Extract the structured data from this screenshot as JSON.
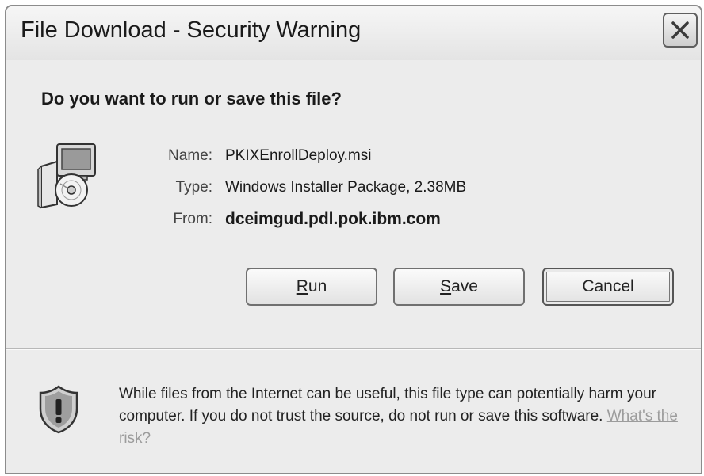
{
  "window": {
    "title": "File Download - Security Warning"
  },
  "question": "Do you want to run or save this file?",
  "file": {
    "name_label": "Name:",
    "name_value": "PKIXEnrollDeploy.msi",
    "type_label": "Type:",
    "type_value": "Windows Installer Package, 2.38MB",
    "from_label": "From:",
    "from_value": "dceimgud.pdl.pok.ibm.com"
  },
  "buttons": {
    "run_rest": "un",
    "run_mnemonic": "R",
    "save_rest": "ave",
    "save_mnemonic": "S",
    "cancel": "Cancel"
  },
  "warning": {
    "text": "While files from the Internet can be useful, this file type can potentially harm your computer. If you do not trust the source, do not run or save this software.",
    "link": "What's the risk?"
  },
  "icons": [
    "installer-package-icon",
    "shield-warning-icon",
    "close-icon"
  ]
}
